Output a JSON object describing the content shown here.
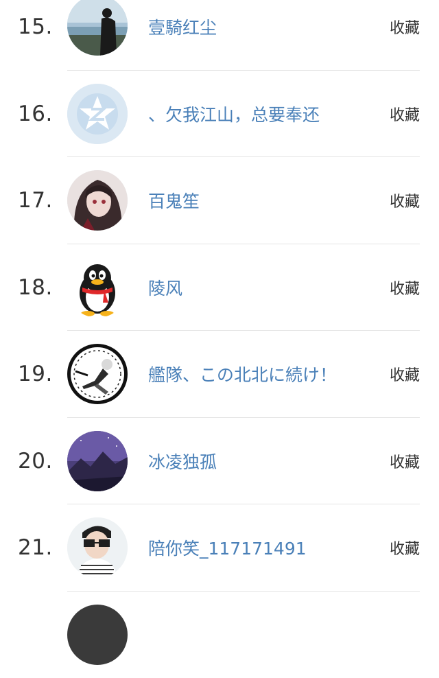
{
  "rows": [
    {
      "rank": "15.",
      "name": "壹騎红尘",
      "action": "收藏",
      "avatar": "silhouette-lake-avatar"
    },
    {
      "rank": "16.",
      "name": "、欠我江山，总要奉还",
      "action": "收藏",
      "avatar": "default-qq-star-avatar"
    },
    {
      "rank": "17.",
      "name": "百鬼笙",
      "action": "收藏",
      "avatar": "anime-girl-avatar"
    },
    {
      "rank": "18.",
      "name": "陵风",
      "action": "收藏",
      "avatar": "qq-penguin-avatar"
    },
    {
      "rank": "19.",
      "name": "艦隊、この北北に続け！",
      "action": "收藏",
      "avatar": "anime-boy-circle-avatar"
    },
    {
      "rank": "20.",
      "name": "冰凌独孤",
      "action": "收藏",
      "avatar": "purple-mountain-avatar"
    },
    {
      "rank": "21.",
      "name": "陪你笑_117171491",
      "action": "收藏",
      "avatar": "boy-glasses-avatar"
    }
  ],
  "colors": {
    "name": "#4a80b8",
    "rank": "#333333",
    "divider": "#e4e4e4"
  }
}
